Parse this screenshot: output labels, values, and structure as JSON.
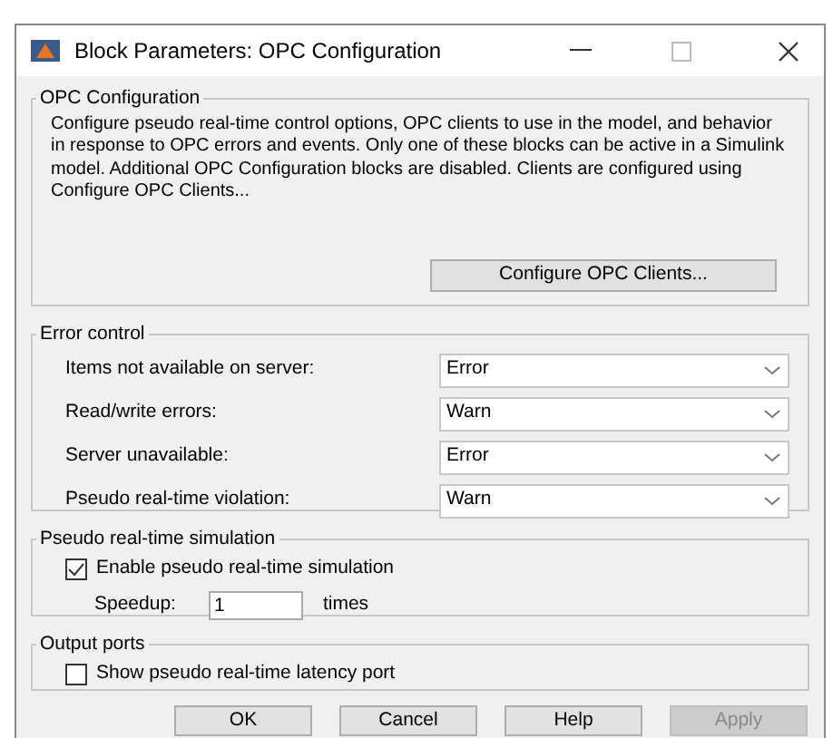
{
  "window": {
    "title": "Block Parameters: OPC Configuration"
  },
  "opc_configuration": {
    "title": "OPC Configuration",
    "description": "Configure pseudo real-time control options, OPC clients to use in the model, and behavior in response to OPC errors and events. Only one of these blocks can be active in a Simulink model. Additional OPC Configuration blocks are disabled. Clients are configured using Configure OPC Clients...",
    "button": "Configure OPC Clients..."
  },
  "error_control": {
    "title": "Error control",
    "rows": [
      {
        "label": "Items not available on server:",
        "value": "Error"
      },
      {
        "label": "Read/write errors:",
        "value": "Warn"
      },
      {
        "label": "Server unavailable:",
        "value": "Error"
      },
      {
        "label": "Pseudo real-time violation:",
        "value": "Warn"
      }
    ]
  },
  "pseudo_real_time_simulation": {
    "title": "Pseudo real-time simulation",
    "enable": {
      "label": "Enable pseudo real-time simulation",
      "checked": true
    },
    "speedup": {
      "label": "Speedup:",
      "value": "1",
      "unit": "times"
    }
  },
  "output_ports": {
    "title": "Output ports",
    "latency_port": {
      "label": "Show pseudo real-time latency port",
      "checked": false
    }
  },
  "buttons": [
    {
      "label": "OK",
      "disabled": false
    },
    {
      "label": "Cancel",
      "disabled": false
    },
    {
      "label": "Help",
      "disabled": false
    },
    {
      "label": "Apply",
      "disabled": true
    }
  ]
}
